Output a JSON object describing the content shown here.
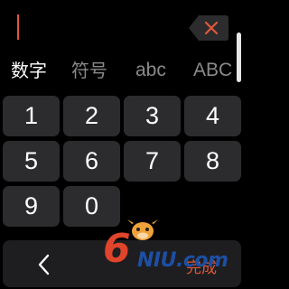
{
  "input": {
    "value": ""
  },
  "tabs": [
    {
      "label": "数字",
      "active": true
    },
    {
      "label": "符号",
      "active": false
    },
    {
      "label": "abc",
      "active": false
    },
    {
      "label": "ABC",
      "active": false
    }
  ],
  "keys": [
    "1",
    "2",
    "3",
    "4",
    "5",
    "6",
    "7",
    "8",
    "9",
    "0"
  ],
  "bottom": {
    "done_label": "完成"
  },
  "watermark": {
    "brand": "6NIU.com"
  },
  "colors": {
    "accent": "#e0573a",
    "key_background": "#2c2c2e",
    "background": "#000000"
  }
}
